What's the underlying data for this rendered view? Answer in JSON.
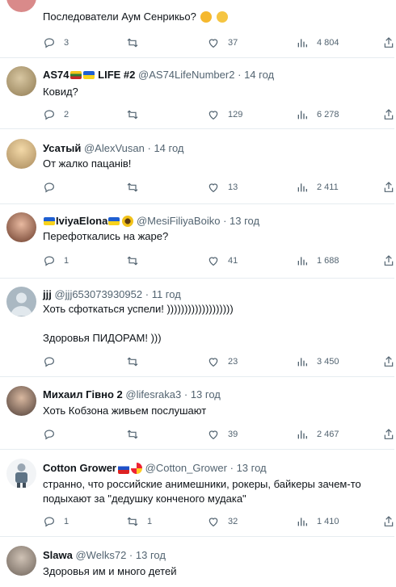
{
  "tweets": [
    {
      "name": "",
      "handle": "",
      "time": "",
      "lines": [
        "Последователи Аум Сенрикьо?"
      ],
      "replies": "3",
      "retweets": "",
      "likes": "37",
      "views": "4 804"
    },
    {
      "name_a": "AS74",
      "name_b": "LIFE #2",
      "handle": "@AS74LifeNumber2",
      "time": "14 год",
      "lines": [
        "Ковид?"
      ],
      "replies": "2",
      "retweets": "",
      "likes": "129",
      "views": "6 278"
    },
    {
      "name": "Усатый",
      "handle": "@AlexVusan",
      "time": "14 год",
      "lines": [
        "От жалко пацанів!"
      ],
      "replies": "",
      "retweets": "",
      "likes": "13",
      "views": "2 411"
    },
    {
      "name": "IviyaElona",
      "handle": "@MesiFiliyaBoiko",
      "time": "13 год",
      "lines": [
        "Перефоткались на жаре?"
      ],
      "replies": "1",
      "retweets": "",
      "likes": "41",
      "views": "1 688"
    },
    {
      "name": "jjj",
      "handle": "@jjj653073930952",
      "time": "11 год",
      "lines": [
        "Хоть сфоткаться успели! )))))))))))))))))))",
        "",
        "Здоровья ПИДОРАМ! )))"
      ],
      "replies": "",
      "retweets": "",
      "likes": "23",
      "views": "3 450"
    },
    {
      "name": "Михаил Гівно 2",
      "handle": "@lifesraka3",
      "time": "13 год",
      "lines": [
        "Хоть Кобзона живьем послушают"
      ],
      "replies": "",
      "retweets": "",
      "likes": "39",
      "views": "2 467"
    },
    {
      "name": "Cotton Grower",
      "handle": "@Cotton_Grower",
      "time": "13 год",
      "lines": [
        "странно, что российские анимешники, рокеры, байкеры зачем-то",
        "подыхают за \"дедушку конченого мудака\""
      ],
      "replies": "1",
      "retweets": "1",
      "likes": "32",
      "views": "1 410"
    },
    {
      "name": "Slawa",
      "handle": "@Welks72",
      "time": "13 год",
      "lines": [
        "Здоровья им и много детей"
      ]
    }
  ],
  "separator": "·",
  "icons": [
    "reply-icon",
    "retweet-icon",
    "like-icon",
    "views-icon",
    "share-icon"
  ],
  "colors": {
    "text": "#0f1419",
    "muted": "#536471",
    "divider": "#e6ecf0"
  }
}
